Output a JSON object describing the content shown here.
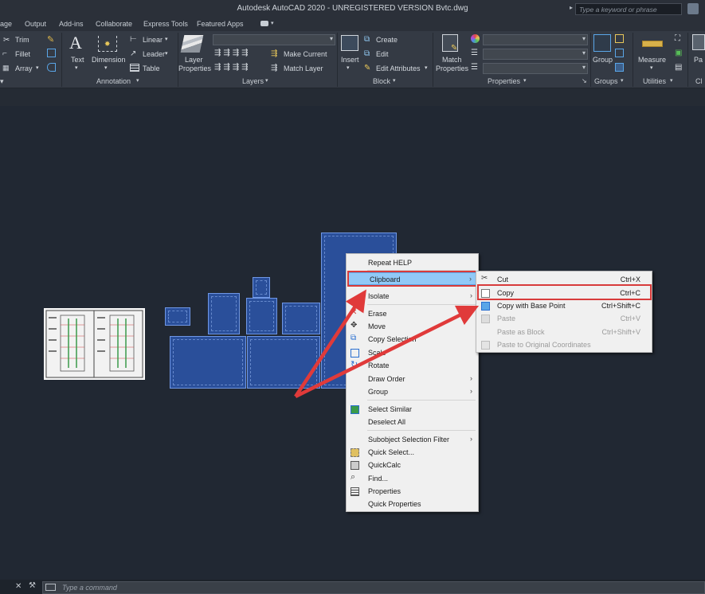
{
  "window": {
    "title": "Autodesk AutoCAD 2020 - UNREGISTERED VERSION    Bvtc.dwg",
    "search_placeholder": "Type a keyword or phrase"
  },
  "menu_tabs": [
    "age",
    "Output",
    "Add-ins",
    "Collaborate",
    "Express Tools",
    "Featured Apps"
  ],
  "ribbon": {
    "modify": {
      "trim": "Trim",
      "fillet": "Fillet",
      "array": "Array"
    },
    "annotation": {
      "text": "Text",
      "dimension": "Dimension",
      "linear": "Linear",
      "leader": "Leader",
      "table": "Table",
      "panel": "Annotation"
    },
    "layers": {
      "layer_properties_1": "Layer",
      "layer_properties_2": "Properties",
      "make_current": "Make Current",
      "match_layer": "Match Layer",
      "panel": "Layers"
    },
    "block": {
      "insert": "Insert",
      "create": "Create",
      "edit": "Edit",
      "edit_attributes": "Edit Attributes",
      "panel": "Block"
    },
    "properties": {
      "match_1": "Match",
      "match_2": "Properties",
      "panel": "Properties"
    },
    "groups": {
      "group": "Group",
      "panel": "Groups"
    },
    "utilities": {
      "measure": "Measure",
      "panel": "Utilities"
    },
    "clipboard": {
      "paste_partial": "Pa",
      "panel_partial": "Cl"
    }
  },
  "context_menu": {
    "items": [
      {
        "label": "Repeat HELP"
      },
      {
        "label": "Clipboard",
        "submenu": true,
        "highlighted": true
      },
      {
        "label": "Isolate",
        "submenu": true
      },
      {
        "label": "Erase"
      },
      {
        "label": "Move"
      },
      {
        "label": "Copy Selection"
      },
      {
        "label": "Scale"
      },
      {
        "label": "Rotate"
      },
      {
        "label": "Draw Order",
        "submenu": true
      },
      {
        "label": "Group",
        "submenu": true
      },
      {
        "label": "Select Similar"
      },
      {
        "label": "Deselect All"
      },
      {
        "label": "Subobject Selection Filter",
        "submenu": true
      },
      {
        "label": "Quick Select..."
      },
      {
        "label": "QuickCalc"
      },
      {
        "label": "Find..."
      },
      {
        "label": "Properties"
      },
      {
        "label": "Quick Properties"
      }
    ]
  },
  "clipboard_submenu": {
    "items": [
      {
        "label": "Cut",
        "shortcut": "Ctrl+X",
        "enabled": true
      },
      {
        "label": "Copy",
        "shortcut": "Ctrl+C",
        "enabled": true,
        "highlighted": true
      },
      {
        "label": "Copy with Base Point",
        "shortcut": "Ctrl+Shift+C",
        "enabled": true
      },
      {
        "label": "Paste",
        "shortcut": "Ctrl+V",
        "enabled": false
      },
      {
        "label": "Paste as Block",
        "shortcut": "Ctrl+Shift+V",
        "enabled": false
      },
      {
        "label": "Paste to Original Coordinates",
        "shortcut": "",
        "enabled": false
      }
    ]
  },
  "command_line": {
    "placeholder": "Type a command"
  },
  "colors": {
    "accent_highlight": "#91c9f7",
    "annotation_red": "#d83b3b",
    "selection_blue": "#2a4f9a"
  }
}
